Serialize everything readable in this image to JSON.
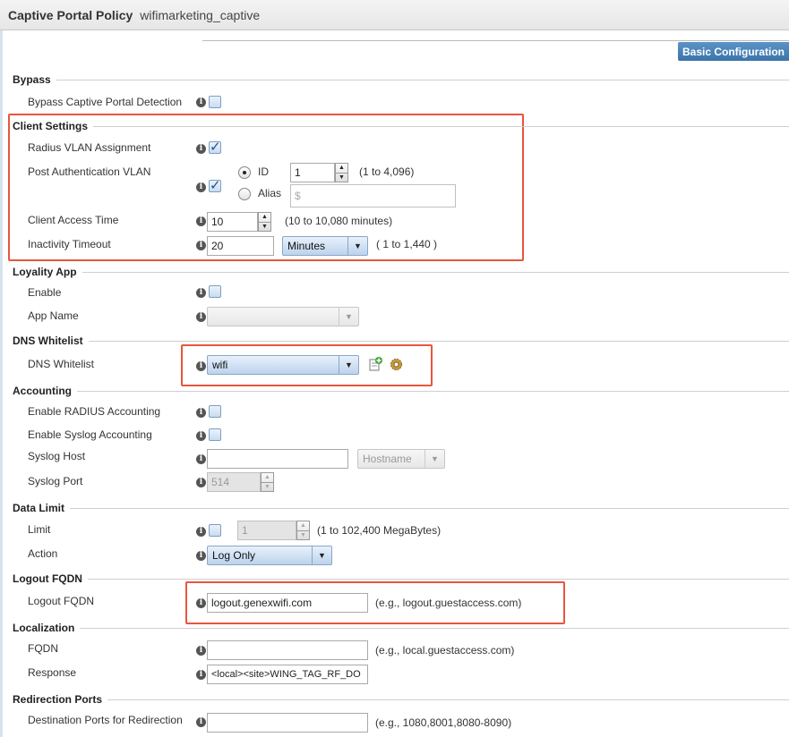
{
  "title": {
    "main": "Captive Portal Policy",
    "name": "wifimarketing_captive"
  },
  "tab": "Basic Configuration",
  "sections": {
    "bypass": "Bypass",
    "client": "Client Settings",
    "loyalty": "Loyality App",
    "dns": "DNS Whitelist",
    "accounting": "Accounting",
    "datalimit": "Data Limit",
    "logout": "Logout FQDN",
    "localization": "Localization",
    "redirection": "Redirection Ports"
  },
  "fields": {
    "bypass_detection": {
      "label": "Bypass Captive Portal Detection",
      "checked": false
    },
    "radius_vlan": {
      "label": "Radius VLAN Assignment",
      "checked": true
    },
    "post_auth_vlan": {
      "label": "Post Authentication VLAN",
      "checked": true,
      "id_label": "ID",
      "id_value": "1",
      "id_range": "(1 to 4,096)",
      "alias_label": "Alias",
      "alias_placeholder": "$"
    },
    "client_access_time": {
      "label": "Client Access Time",
      "value": "10",
      "range": "(10 to 10,080 minutes)"
    },
    "inactivity_timeout": {
      "label": "Inactivity Timeout",
      "value": "20",
      "unit": "Minutes",
      "range": "( 1 to 1,440 )"
    },
    "loyalty_enable": {
      "label": "Enable",
      "checked": false
    },
    "app_name": {
      "label": "App Name",
      "value": ""
    },
    "dns_whitelist": {
      "label": "DNS Whitelist",
      "value": "wifi"
    },
    "radius_accounting": {
      "label": "Enable RADIUS Accounting",
      "checked": false
    },
    "syslog_accounting": {
      "label": "Enable Syslog Accounting",
      "checked": false
    },
    "syslog_host": {
      "label": "Syslog Host",
      "value": "",
      "type": "Hostname"
    },
    "syslog_port": {
      "label": "Syslog Port",
      "value": "514"
    },
    "limit": {
      "label": "Limit",
      "value": "1",
      "range": "(1 to 102,400 MegaBytes)"
    },
    "action": {
      "label": "Action",
      "value": "Log Only"
    },
    "logout_fqdn": {
      "label": "Logout FQDN",
      "value": "logout.genexwifi.com",
      "hint": "(e.g., logout.guestaccess.com)"
    },
    "fqdn": {
      "label": "FQDN",
      "value": "",
      "hint": "(e.g., local.guestaccess.com)"
    },
    "response": {
      "label": "Response",
      "value": "<local><site>WING_TAG_RF_DO"
    },
    "dest_ports": {
      "label": "Destination Ports for Redirection",
      "value": "",
      "hint": "(e.g., 1080,8001,8080-8090)"
    }
  },
  "icons": {
    "info": "info-icon",
    "add": "add-icon",
    "configure": "gear-icon"
  },
  "colors": {
    "highlight": "#e8553e",
    "tab": "#3b74a9"
  }
}
